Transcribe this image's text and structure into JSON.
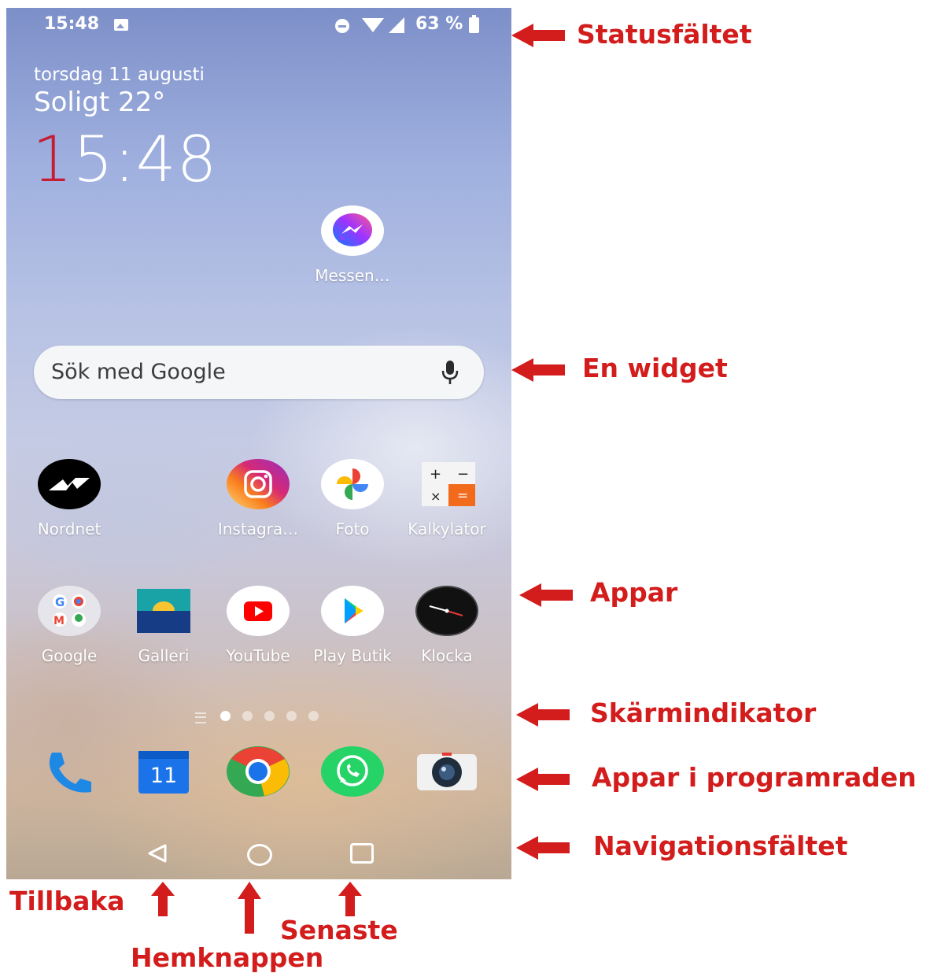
{
  "status_bar": {
    "time": "15:48",
    "battery": "63 %"
  },
  "lock_widget": {
    "date": "torsdag 11 augusti",
    "weather": "Soligt 22°",
    "clock_first": "1",
    "clock_rest": "5:48"
  },
  "search_widget": {
    "placeholder": "Sök med Google"
  },
  "apps": {
    "messenger": "Messen…",
    "row1": [
      "Nordnet",
      "Instagra…",
      "Foto",
      "Kalkylator"
    ],
    "row2": [
      "Google",
      "Galleri",
      "YouTube",
      "Play Butik",
      "Klocka"
    ]
  },
  "dock": {
    "calendar_day": "11"
  },
  "annotations": {
    "status_bar": "Statusfältet",
    "widget": "En widget",
    "apps": "Appar",
    "screen_indicator": "Skärmindikator",
    "dock_apps": "Appar i programraden",
    "nav_bar": "Navigationsfältet",
    "back": "Tillbaka",
    "home": "Hemknappen",
    "recents": "Senaste"
  },
  "colors": {
    "annotation_red": "#d31c1c",
    "clock_red": "#c51d34"
  }
}
